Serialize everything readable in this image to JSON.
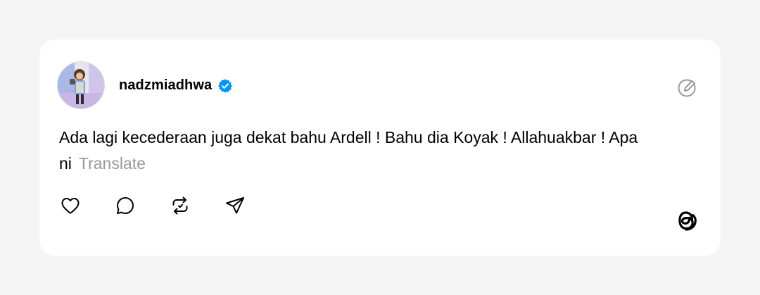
{
  "post": {
    "username": "nadzmiadhwa",
    "verified": true,
    "text": "Ada lagi kecederaan juga dekat bahu Ardell ! Bahu dia Koyak ! Allahuakbar ! Apa ni",
    "translate_label": "Translate"
  },
  "icons": {
    "avatar": "user-avatar",
    "verified": "verified-badge-icon",
    "edit": "edit-icon",
    "like": "heart-icon",
    "comment": "comment-icon",
    "repost": "repost-icon",
    "share": "send-icon",
    "logo": "threads-logo"
  },
  "colors": {
    "verified_blue": "#0095f6",
    "secondary_text": "#999999",
    "icon": "#000000"
  }
}
